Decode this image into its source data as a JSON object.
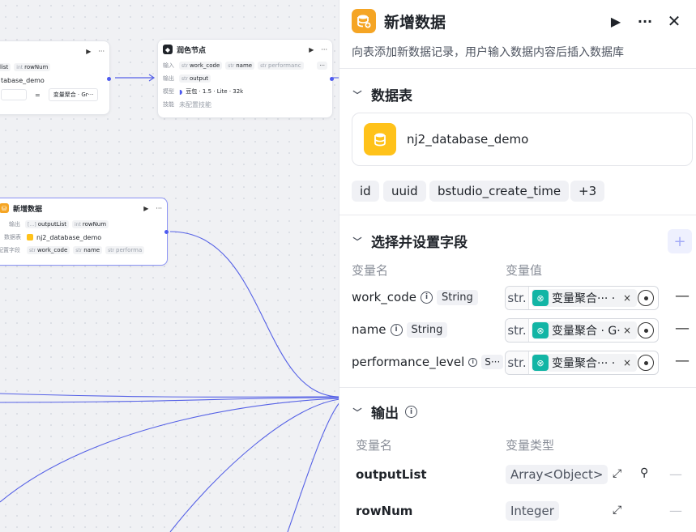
{
  "canvas": {
    "node_top_left": {
      "row1_chip_type": "int",
      "row1_chip_label": "rowNum",
      "row1_partial": "list",
      "row2_text": "tabase_demo",
      "row3_eq": "=",
      "row3_value": "变量聚合 · Gr···"
    },
    "node_polish": {
      "title": "润色节点",
      "input_label": "输入",
      "input_chips": [
        {
          "type": "str",
          "label": "work_code"
        },
        {
          "type": "str",
          "label": "name"
        },
        {
          "type": "str",
          "label": "performanc"
        }
      ],
      "more": "···",
      "output_label": "输出",
      "output_chip": {
        "type": "str",
        "label": "output"
      },
      "model_label": "模型",
      "model_value": "豆包 · 1.5 · Lite · 32k",
      "skill_label": "技能",
      "skill_value": "未配置技能"
    },
    "node_insert": {
      "title": "新增数据",
      "output_label": "输出",
      "output_chips": [
        {
          "type": "[…]",
          "label": "outputList"
        },
        {
          "type": "int",
          "label": "rowNum"
        }
      ],
      "table_label": "数据表",
      "table_value": "nj2_database_demo",
      "fields_label": "配置字段",
      "field_chips": [
        {
          "type": "str",
          "label": "work_code"
        },
        {
          "type": "str",
          "label": "name"
        },
        {
          "type": "str",
          "label": "performa"
        }
      ]
    }
  },
  "panel": {
    "title": "新增数据",
    "description": "向表添加新数据记录，用户输入数据内容后插入数据库",
    "sections": {
      "table": {
        "title": "数据表",
        "db_name": "nj2_database_demo",
        "tags": [
          "id",
          "uuid",
          "bstudio_create_time",
          "+3"
        ]
      },
      "fields": {
        "title": "选择并设置字段",
        "add_label": "+",
        "col_name": "变量名",
        "col_value": "变量值",
        "rows": [
          {
            "name": "work_code",
            "type": "String",
            "prefix": "str.",
            "ref": "变量聚合··· ·"
          },
          {
            "name": "name",
            "type": "String",
            "prefix": "str.",
            "ref": "变量聚合 · G·"
          },
          {
            "name": "performance_level",
            "type": "S···",
            "prefix": "str.",
            "ref": "变量聚合··· ·"
          }
        ],
        "remove_label": "—",
        "clear_label": "×"
      },
      "output": {
        "title": "输出",
        "col_name": "变量名",
        "col_type": "变量类型",
        "rows": [
          {
            "name": "outputList",
            "type": "Array<Object>"
          },
          {
            "name": "rowNum",
            "type": "Integer"
          }
        ],
        "remove_label": "—"
      }
    }
  },
  "colors": {
    "accent": "#4e5bf0",
    "edge": "#5561e6",
    "db_icon": "#ffc21a",
    "ref_icon": "#12b5a5",
    "node_icon_orange": "#f5a524"
  }
}
